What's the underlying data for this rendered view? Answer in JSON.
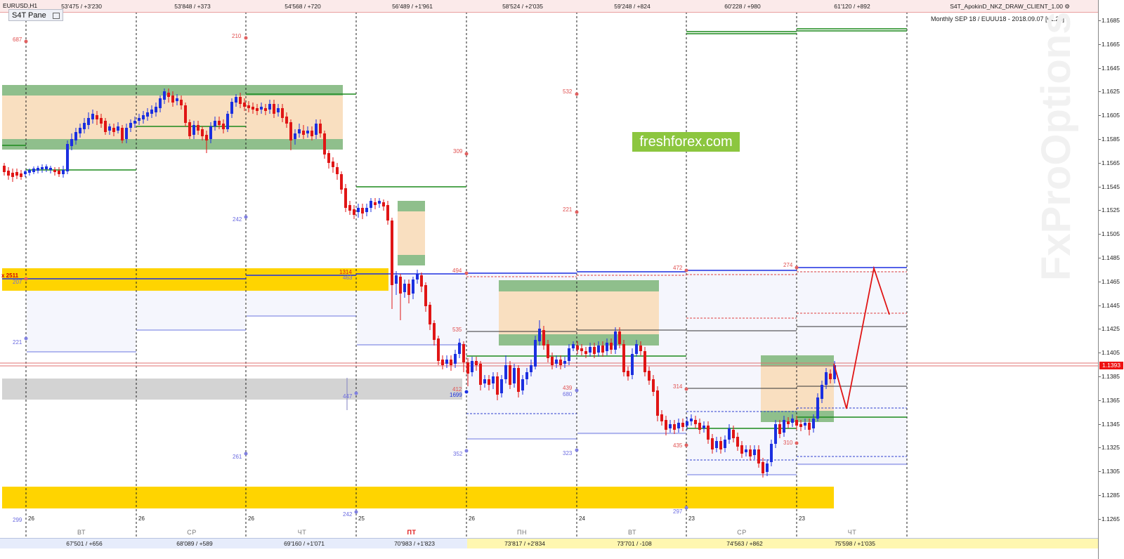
{
  "header": {
    "symbol": "EURUSD,H1",
    "pane_tab": "S4T Pane",
    "client": "S4T_ApokinD_NKZ_DRAW_CLIENT_1.00",
    "info": "Monthly SEP 18 / EUUU18 - 2018.09.07 [v1.24]",
    "client_icon": "settings-icon"
  },
  "top_strip": [
    "53'475 / +3'230",
    "53'848 / +373",
    "54'568 / +720",
    "56'489 / +1'961",
    "58'524 / +2'035",
    "59'248 / +824",
    "60'228 / +980",
    "61'120 / +892"
  ],
  "bottom_strip": [
    "67'501 / +656",
    "68'089 / +589",
    "69'160 / +1'071",
    "70'983 / +1'823",
    "73'817 / +2'834",
    "73'701 / -108",
    "74'563 / +862",
    "75'598 / +1'035"
  ],
  "days": [
    "ВТ",
    "СР",
    "ЧТ",
    "ПТ",
    "ПН",
    "ВТ",
    "СР",
    "ЧТ"
  ],
  "day_numbers": [
    "26",
    "26",
    "26",
    "25",
    "26",
    "24",
    "23",
    "23"
  ],
  "watermark": "freshforex.com",
  "brand": "FxProOptions",
  "current_price": "1.1393",
  "price_ticks": [
    "1.1685",
    "1.1665",
    "1.1645",
    "1.1625",
    "1.1605",
    "1.1585",
    "1.1565",
    "1.1545",
    "1.1525",
    "1.1505",
    "1.1485",
    "1.1465",
    "1.1445",
    "1.1425",
    "1.1405",
    "1.1385",
    "1.1365",
    "1.1345",
    "1.1325",
    "1.1305",
    "1.1285",
    "1.1265"
  ],
  "levels_red": [
    "687",
    "210",
    "309",
    "532",
    "221",
    "494",
    "472",
    "274",
    "535",
    "412",
    "439",
    "314",
    "435",
    "310",
    "1314",
    "x 2511"
  ],
  "levels_blue": [
    "242",
    "221",
    "261",
    "299",
    "447",
    "1699",
    "352",
    "680",
    "323",
    "297",
    "242",
    "463",
    "207"
  ],
  "colors": {
    "bull": "#1b2fe0",
    "bear": "#e01515",
    "zone_fill": "#f9dfc0",
    "zone_band": "#8fbf8c",
    "yellow": "#ffd400",
    "gray": "#d3d3d3"
  }
}
